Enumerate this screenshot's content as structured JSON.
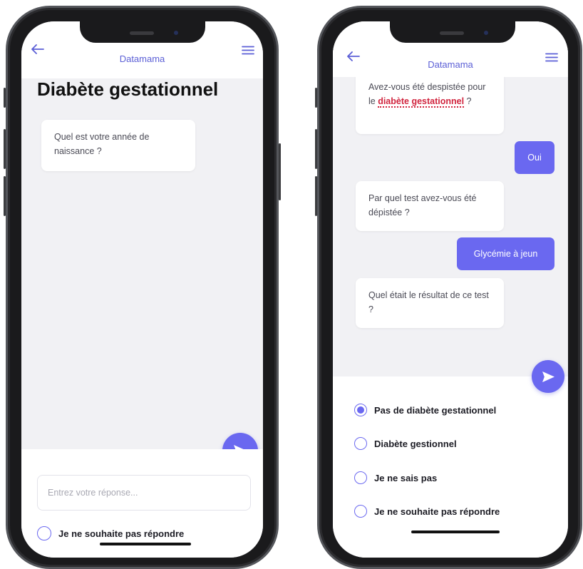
{
  "colors": {
    "accent": "#6a68f0",
    "highlight": "#d1243e",
    "chat_bg": "#f1f1f4"
  },
  "left_screen": {
    "header": {
      "title": "Datamama",
      "back_icon": "arrow-left-icon",
      "menu_icon": "hamburger-menu-icon"
    },
    "heading": "Diabète gestationnel",
    "messages": [
      {
        "from": "bot",
        "text": "Quel est votre année de naissance ?"
      }
    ],
    "input": {
      "placeholder": "Entrez votre réponse...",
      "value": ""
    },
    "option": {
      "label": "Je ne souhaite pas répondre",
      "selected": false
    }
  },
  "right_screen": {
    "header": {
      "title": "Datamama",
      "back_icon": "arrow-left-icon",
      "menu_icon": "hamburger-menu-icon"
    },
    "messages": [
      {
        "from": "bot",
        "text_before": "Avez-vous été despistée pour le ",
        "highlight": "diabète gestationnel",
        "text_after": " ?"
      },
      {
        "from": "user",
        "text": "Oui"
      },
      {
        "from": "bot",
        "text": "Par quel test avez-vous été dépistée ?"
      },
      {
        "from": "user",
        "text": "Glycémie à jeun"
      },
      {
        "from": "bot",
        "text": "Quel était le résultat de ce test ?"
      }
    ],
    "options": [
      {
        "label": "Pas de diabète gestationnel",
        "selected": true
      },
      {
        "label": "Diabète gestionnel",
        "selected": false
      },
      {
        "label": "Je ne sais pas",
        "selected": false
      },
      {
        "label": "Je ne souhaite pas répondre",
        "selected": false
      }
    ]
  }
}
